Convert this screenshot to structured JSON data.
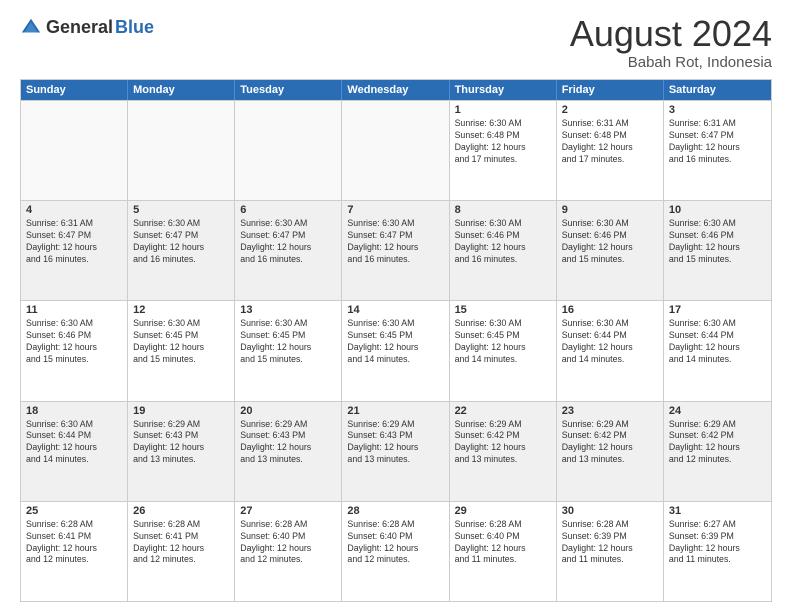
{
  "header": {
    "logo_general": "General",
    "logo_blue": "Blue",
    "month_title": "August 2024",
    "location": "Babah Rot, Indonesia"
  },
  "calendar": {
    "days": [
      "Sunday",
      "Monday",
      "Tuesday",
      "Wednesday",
      "Thursday",
      "Friday",
      "Saturday"
    ],
    "rows": [
      [
        {
          "day": "",
          "text": "",
          "empty": true
        },
        {
          "day": "",
          "text": "",
          "empty": true
        },
        {
          "day": "",
          "text": "",
          "empty": true
        },
        {
          "day": "",
          "text": "",
          "empty": true
        },
        {
          "day": "1",
          "text": "Sunrise: 6:30 AM\nSunset: 6:48 PM\nDaylight: 12 hours\nand 17 minutes."
        },
        {
          "day": "2",
          "text": "Sunrise: 6:31 AM\nSunset: 6:48 PM\nDaylight: 12 hours\nand 17 minutes."
        },
        {
          "day": "3",
          "text": "Sunrise: 6:31 AM\nSunset: 6:47 PM\nDaylight: 12 hours\nand 16 minutes."
        }
      ],
      [
        {
          "day": "4",
          "text": "Sunrise: 6:31 AM\nSunset: 6:47 PM\nDaylight: 12 hours\nand 16 minutes.",
          "shaded": true
        },
        {
          "day": "5",
          "text": "Sunrise: 6:30 AM\nSunset: 6:47 PM\nDaylight: 12 hours\nand 16 minutes.",
          "shaded": true
        },
        {
          "day": "6",
          "text": "Sunrise: 6:30 AM\nSunset: 6:47 PM\nDaylight: 12 hours\nand 16 minutes.",
          "shaded": true
        },
        {
          "day": "7",
          "text": "Sunrise: 6:30 AM\nSunset: 6:47 PM\nDaylight: 12 hours\nand 16 minutes.",
          "shaded": true
        },
        {
          "day": "8",
          "text": "Sunrise: 6:30 AM\nSunset: 6:46 PM\nDaylight: 12 hours\nand 16 minutes.",
          "shaded": true
        },
        {
          "day": "9",
          "text": "Sunrise: 6:30 AM\nSunset: 6:46 PM\nDaylight: 12 hours\nand 15 minutes.",
          "shaded": true
        },
        {
          "day": "10",
          "text": "Sunrise: 6:30 AM\nSunset: 6:46 PM\nDaylight: 12 hours\nand 15 minutes.",
          "shaded": true
        }
      ],
      [
        {
          "day": "11",
          "text": "Sunrise: 6:30 AM\nSunset: 6:46 PM\nDaylight: 12 hours\nand 15 minutes."
        },
        {
          "day": "12",
          "text": "Sunrise: 6:30 AM\nSunset: 6:45 PM\nDaylight: 12 hours\nand 15 minutes."
        },
        {
          "day": "13",
          "text": "Sunrise: 6:30 AM\nSunset: 6:45 PM\nDaylight: 12 hours\nand 15 minutes."
        },
        {
          "day": "14",
          "text": "Sunrise: 6:30 AM\nSunset: 6:45 PM\nDaylight: 12 hours\nand 14 minutes."
        },
        {
          "day": "15",
          "text": "Sunrise: 6:30 AM\nSunset: 6:45 PM\nDaylight: 12 hours\nand 14 minutes."
        },
        {
          "day": "16",
          "text": "Sunrise: 6:30 AM\nSunset: 6:44 PM\nDaylight: 12 hours\nand 14 minutes."
        },
        {
          "day": "17",
          "text": "Sunrise: 6:30 AM\nSunset: 6:44 PM\nDaylight: 12 hours\nand 14 minutes."
        }
      ],
      [
        {
          "day": "18",
          "text": "Sunrise: 6:30 AM\nSunset: 6:44 PM\nDaylight: 12 hours\nand 14 minutes.",
          "shaded": true
        },
        {
          "day": "19",
          "text": "Sunrise: 6:29 AM\nSunset: 6:43 PM\nDaylight: 12 hours\nand 13 minutes.",
          "shaded": true
        },
        {
          "day": "20",
          "text": "Sunrise: 6:29 AM\nSunset: 6:43 PM\nDaylight: 12 hours\nand 13 minutes.",
          "shaded": true
        },
        {
          "day": "21",
          "text": "Sunrise: 6:29 AM\nSunset: 6:43 PM\nDaylight: 12 hours\nand 13 minutes.",
          "shaded": true
        },
        {
          "day": "22",
          "text": "Sunrise: 6:29 AM\nSunset: 6:42 PM\nDaylight: 12 hours\nand 13 minutes.",
          "shaded": true
        },
        {
          "day": "23",
          "text": "Sunrise: 6:29 AM\nSunset: 6:42 PM\nDaylight: 12 hours\nand 13 minutes.",
          "shaded": true
        },
        {
          "day": "24",
          "text": "Sunrise: 6:29 AM\nSunset: 6:42 PM\nDaylight: 12 hours\nand 12 minutes.",
          "shaded": true
        }
      ],
      [
        {
          "day": "25",
          "text": "Sunrise: 6:28 AM\nSunset: 6:41 PM\nDaylight: 12 hours\nand 12 minutes."
        },
        {
          "day": "26",
          "text": "Sunrise: 6:28 AM\nSunset: 6:41 PM\nDaylight: 12 hours\nand 12 minutes."
        },
        {
          "day": "27",
          "text": "Sunrise: 6:28 AM\nSunset: 6:40 PM\nDaylight: 12 hours\nand 12 minutes."
        },
        {
          "day": "28",
          "text": "Sunrise: 6:28 AM\nSunset: 6:40 PM\nDaylight: 12 hours\nand 12 minutes."
        },
        {
          "day": "29",
          "text": "Sunrise: 6:28 AM\nSunset: 6:40 PM\nDaylight: 12 hours\nand 11 minutes."
        },
        {
          "day": "30",
          "text": "Sunrise: 6:28 AM\nSunset: 6:39 PM\nDaylight: 12 hours\nand 11 minutes."
        },
        {
          "day": "31",
          "text": "Sunrise: 6:27 AM\nSunset: 6:39 PM\nDaylight: 12 hours\nand 11 minutes."
        }
      ]
    ]
  }
}
